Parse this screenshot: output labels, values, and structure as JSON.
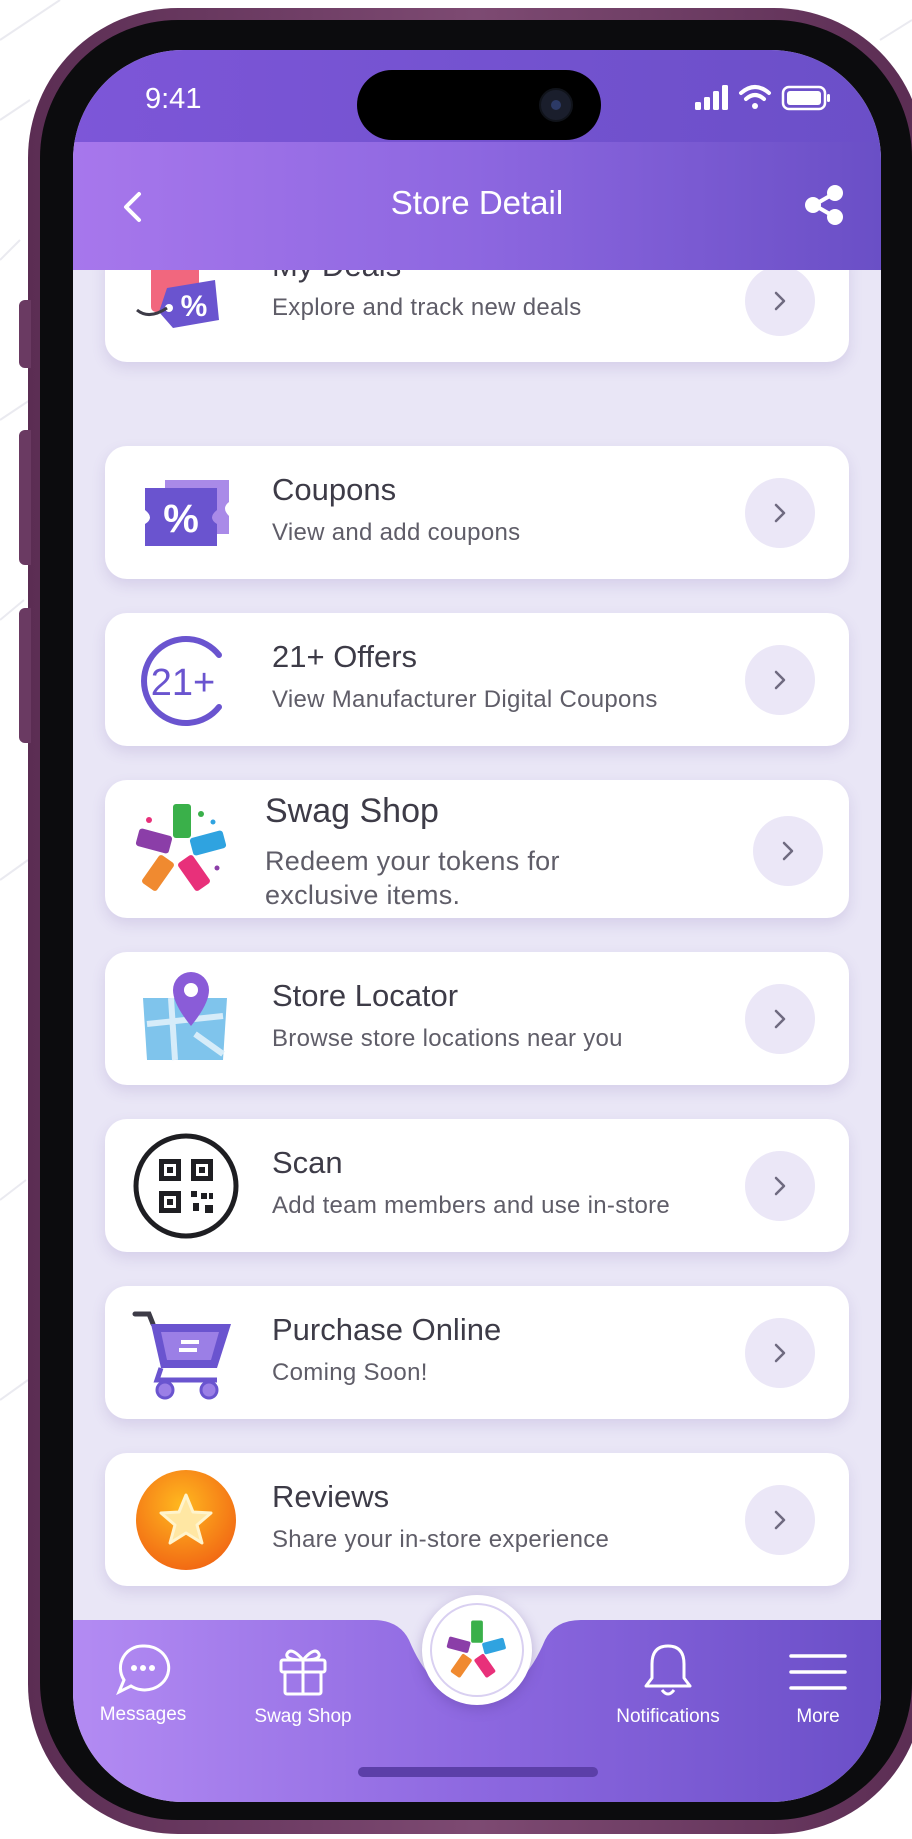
{
  "status_bar": {
    "time": "9:41"
  },
  "header": {
    "title": "Store Detail"
  },
  "menu_items": [
    {
      "title": "My Deals",
      "subtitle": "Explore and track new deals",
      "icon": "deals-tag-icon"
    },
    {
      "title": "Coupons",
      "subtitle": "View and add coupons",
      "icon": "coupon-ticket-icon"
    },
    {
      "title": "21+ Offers",
      "subtitle": "View Manufacturer Digital Coupons",
      "icon": "twenty-one-plus-icon"
    },
    {
      "title": "Swag Shop",
      "subtitle_line1": "Redeem your tokens for",
      "subtitle_line2": "exclusive items.",
      "icon": "swag-tags-icon"
    },
    {
      "title": "Store Locator",
      "subtitle": "Browse store locations near you",
      "icon": "map-pin-icon"
    },
    {
      "title": "Scan",
      "subtitle": "Add team members and use in-store",
      "icon": "qr-code-icon"
    },
    {
      "title": "Purchase Online",
      "subtitle": "Coming Soon!",
      "icon": "shopping-cart-icon"
    },
    {
      "title": "Reviews",
      "subtitle": "Share your in-store experience",
      "icon": "star-icon"
    }
  ],
  "bottom_nav": {
    "messages": "Messages",
    "swag_shop": "Swag Shop",
    "notifications": "Notifications",
    "more": "More"
  },
  "colors": {
    "header_start": "#a777ec",
    "header_end": "#6a4fc6",
    "screen_background": "#e9e6f6",
    "chevron_button": "#ebe7f7",
    "title_text": "#3d3b47"
  }
}
